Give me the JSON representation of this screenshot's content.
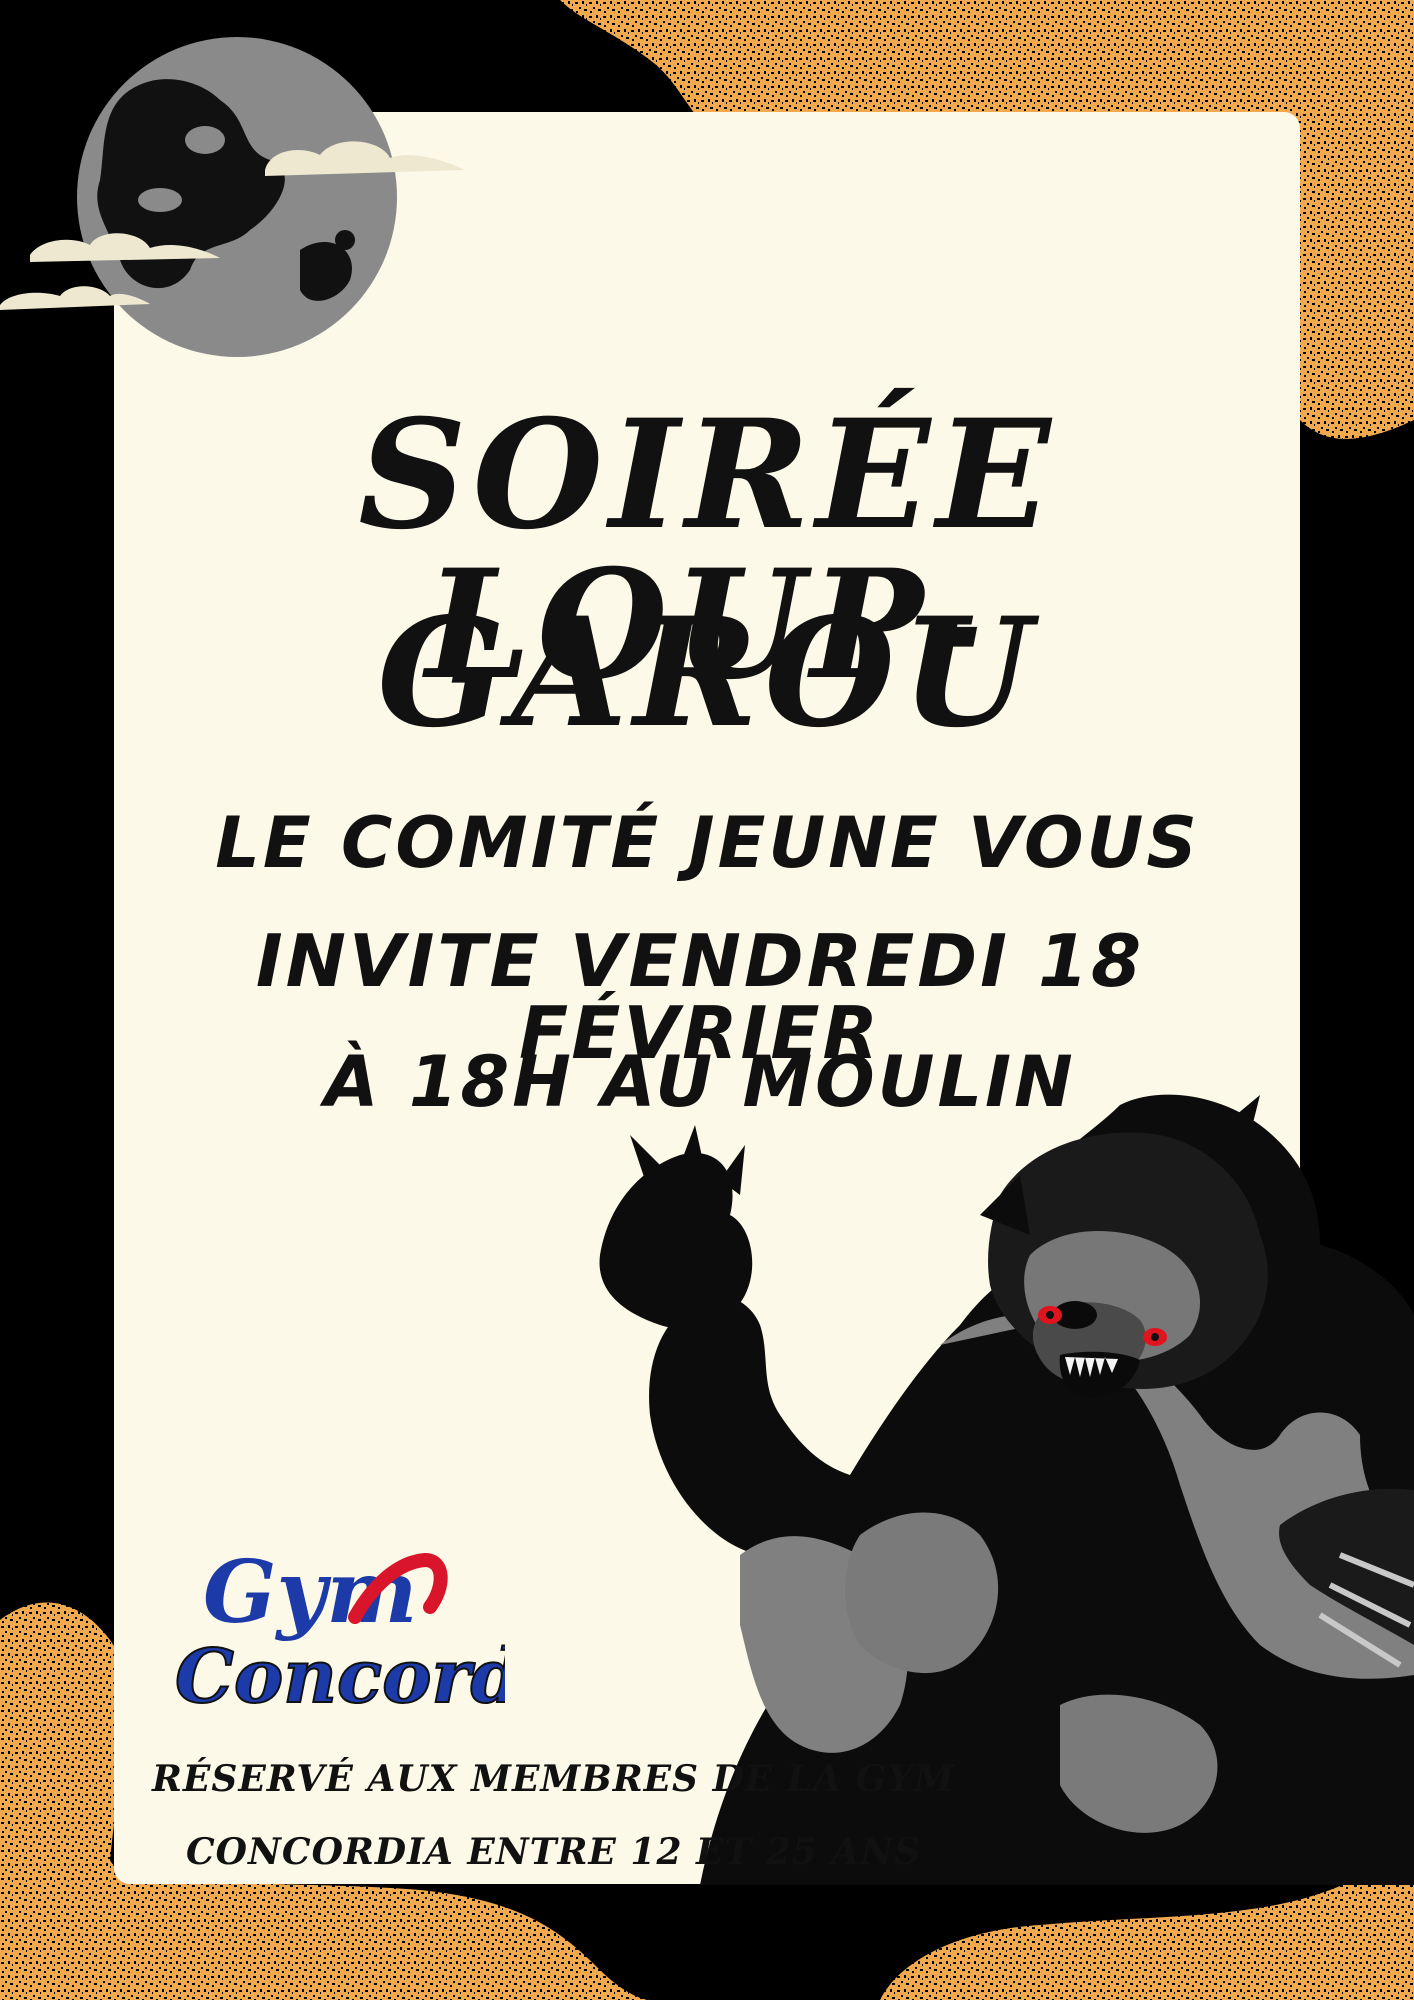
{
  "poster": {
    "title_line1": "SOIRÉE LOUP-",
    "title_line2": "GAROU",
    "invite_line1": "LE COMITÉ JEUNE  VOUS",
    "invite_line2": "INVITE VENDREDI 18 FÉVRIER",
    "invite_line3": "À 18H AU MOULIN",
    "footer_line1": "RÉSERVÉ AUX MEMBRES DE LA GYM",
    "footer_line2": "CONCORDIA ENTRE 12 ET 25 ANS"
  },
  "logo": {
    "line1": "Gym",
    "line2": "Concordia"
  },
  "colors": {
    "background": "#000000",
    "panel": "#fdf9e8",
    "texture": "#f0a94e",
    "moon": "#8a8a8a",
    "cloud": "#ede8cf",
    "logo_blue": "#1c3aa8",
    "logo_red": "#d8152a",
    "wolf_eye": "#e0141e"
  },
  "icons": [
    "full-moon-icon",
    "cloud-icon",
    "werewolf-illustration",
    "gym-concordia-logo"
  ]
}
